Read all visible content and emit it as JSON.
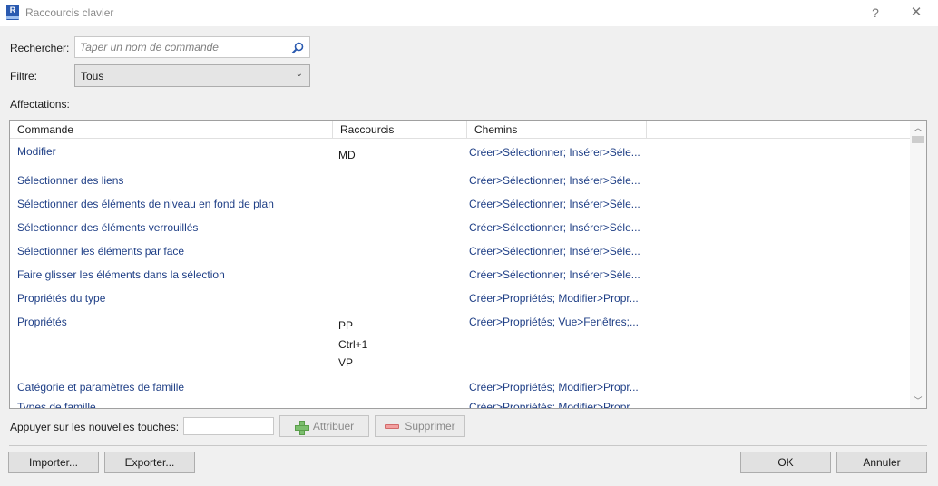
{
  "window": {
    "title": "Raccourcis clavier",
    "icon_text": "R",
    "help_label": "?",
    "close_label": "✕"
  },
  "search": {
    "label": "Rechercher:",
    "placeholder": "Taper un nom de commande",
    "value": ""
  },
  "filter": {
    "label": "Filtre:",
    "selected": "Tous"
  },
  "assignments": {
    "label": "Affectations:",
    "columns": [
      "Commande",
      "Raccourcis",
      "Chemins"
    ],
    "rows": [
      {
        "command": "Modifier",
        "keys": [
          "MD"
        ],
        "path": "Créer>Sélectionner; Insérer>Séle..."
      },
      {
        "command": "Sélectionner des liens",
        "keys": [],
        "path": "Créer>Sélectionner; Insérer>Séle..."
      },
      {
        "command": "Sélectionner des éléments de niveau en fond de plan",
        "keys": [],
        "path": "Créer>Sélectionner; Insérer>Séle..."
      },
      {
        "command": "Sélectionner des éléments verrouillés",
        "keys": [],
        "path": "Créer>Sélectionner; Insérer>Séle..."
      },
      {
        "command": "Sélectionner les éléments par face",
        "keys": [],
        "path": "Créer>Sélectionner; Insérer>Séle..."
      },
      {
        "command": "Faire glisser les éléments dans la sélection",
        "keys": [],
        "path": "Créer>Sélectionner; Insérer>Séle..."
      },
      {
        "command": "Propriétés du type",
        "keys": [],
        "path": "Créer>Propriétés; Modifier>Propr..."
      },
      {
        "command": "Propriétés",
        "keys": [
          "PP",
          "Ctrl+1",
          "VP"
        ],
        "path": "Créer>Propriétés; Vue>Fenêtres;..."
      },
      {
        "command": "Catégorie et paramètres de famille",
        "keys": [],
        "path": "Créer>Propriétés; Modifier>Propr..."
      },
      {
        "command": "Types de famille",
        "keys": [],
        "path": "Créer>Propriétés; Modifier>Propr..."
      }
    ]
  },
  "new_keys": {
    "label": "Appuyer sur les nouvelles touches:",
    "value": "",
    "assign_label": "Attribuer",
    "remove_label": "Supprimer"
  },
  "footer": {
    "import_label": "Importer...",
    "export_label": "Exporter...",
    "ok_label": "OK",
    "cancel_label": "Annuler"
  }
}
